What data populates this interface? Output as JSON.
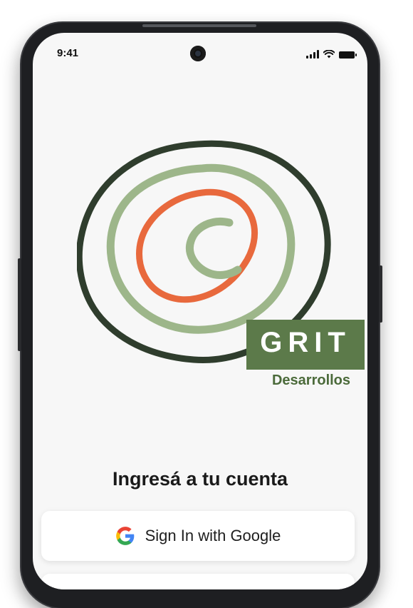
{
  "status_bar": {
    "time": "9:41",
    "icons": [
      "signal-icon",
      "wifi-icon",
      "battery-icon"
    ]
  },
  "logo": {
    "brand": "GRIT",
    "subtitle": "Desarrollos",
    "colors": {
      "dark_green": "#2f3d2d",
      "sage": "#9db68a",
      "orange": "#e8693d",
      "box_green": "#5c7a4a",
      "text_green": "#4b6a3a"
    }
  },
  "login": {
    "title": "Ingresá a tu cuenta",
    "google_button_label": "Sign In with Google",
    "google_icon": "google-icon"
  }
}
